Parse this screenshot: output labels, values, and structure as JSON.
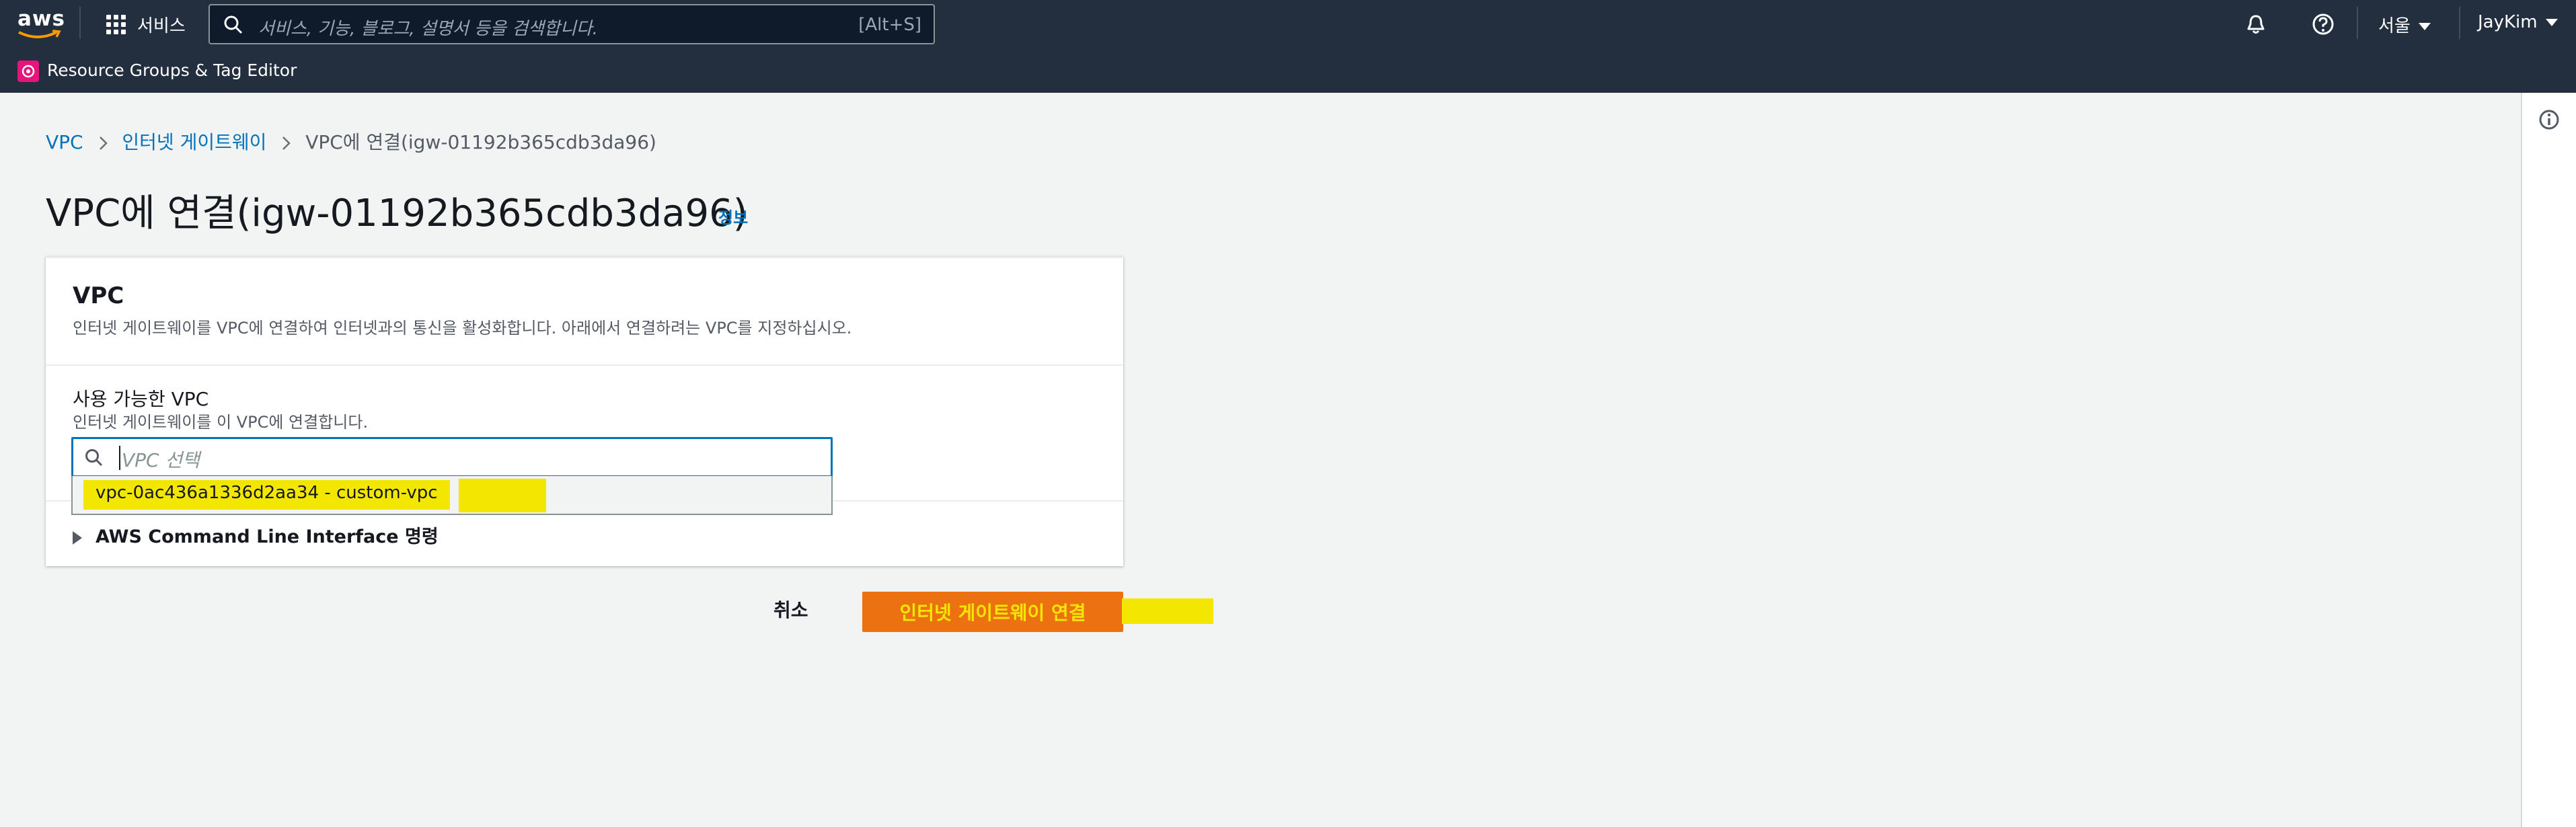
{
  "nav": {
    "logo": "aws",
    "services_label": "서비스",
    "search_placeholder": "서비스, 기능, 블로그, 설명서 등을 검색합니다.",
    "search_shortcut": "[Alt+S]",
    "region": "서울",
    "user": "JayKim",
    "pinned_service": "Resource Groups & Tag Editor"
  },
  "breadcrumb": {
    "items": [
      "VPC",
      "인터넷 게이트웨이"
    ],
    "current": "VPC에 연결(igw-01192b365cdb3da96)"
  },
  "page": {
    "title": "VPC에 연결(igw-01192b365cdb3da96)",
    "info_link": "정보"
  },
  "panel": {
    "title": "VPC",
    "description": "인터넷 게이트웨이를 VPC에 연결하여 인터넷과의 통신을 활성화합니다. 아래에서 연결하려는 VPC를 지정하십시오.",
    "field_label": "사용 가능한 VPC",
    "field_description": "인터넷 게이트웨이를 이 VPC에 연결합니다.",
    "select_placeholder": "VPC 선택",
    "option": "vpc-0ac436a1336d2aa34 - custom-vpc",
    "cli_label": "AWS Command Line Interface 명령"
  },
  "actions": {
    "cancel": "취소",
    "submit": "인터넷 게이트웨이 연결"
  },
  "colors": {
    "nav_bg": "#232f3e",
    "link": "#0073bb",
    "primary": "#ec7211",
    "highlight": "#f3e600",
    "rg_icon": "#e7157b"
  },
  "icons": [
    "aws-logo",
    "grid-icon",
    "search-icon",
    "bell-icon",
    "help-icon",
    "resource-groups-icon",
    "info-icon",
    "chevron-right-icon",
    "caret-right-icon"
  ]
}
